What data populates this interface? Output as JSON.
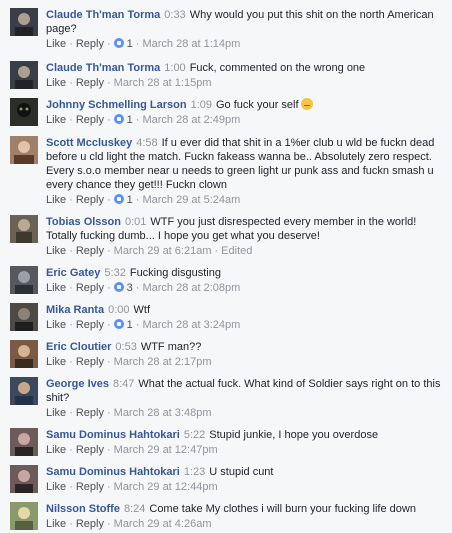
{
  "comments": [
    {
      "name": "Claude Th'man Torma",
      "time": "0:33",
      "text": "Why would you put this shit on the north American page?",
      "like": "Like",
      "reply": "Reply",
      "reactions": "1",
      "date": "March 28 at 1:14pm",
      "avatar": "#3a3f47"
    },
    {
      "name": "Claude Th'man Torma",
      "time": "1:00",
      "text": "Fuck, commented on the wrong one",
      "like": "Like",
      "reply": "Reply",
      "reactions": "",
      "date": "March 28 at 1:15pm",
      "avatar": "#3a3f47"
    },
    {
      "name": "Johnny Schmelling Larson",
      "time": "1:09",
      "text": "Go fuck your self",
      "like": "Like",
      "reply": "Reply",
      "reactions": "1",
      "date": "March 28 at 2:49pm",
      "avatar": "#2b2f2a"
    },
    {
      "name": "Scott Mccluskey",
      "time": "4:58",
      "text": "If u ever did that shit in a 1%er club u wld be fuckn dead before u cld light the match. Fuckn fakeass wanna be.. Absolutely zero respect. Every s.o.o member near u needs to green light ur punk ass and fuckn smash u every chance they get!!! Fuckn clown",
      "like": "Like",
      "reply": "Reply",
      "reactions": "1",
      "date": "March 29 at 5:24am",
      "avatar": "#a08068"
    },
    {
      "name": "Tobias Olsson",
      "time": "0:01",
      "text": "WTF you just disrespected every member in the world! Totally fucking dumb... I hope you get what you deserve!",
      "like": "Like",
      "reply": "Reply",
      "reactions": "",
      "date": "March 29 at 6:21am",
      "edited": "Edited",
      "avatar": "#6a6255"
    },
    {
      "name": "Eric Gatey",
      "time": "5:32",
      "text": "Fucking disgusting",
      "like": "Like",
      "reply": "Reply",
      "reactions": "3",
      "date": "March 28 at 2:08pm",
      "avatar": "#55585c"
    },
    {
      "name": "Mika Ranta",
      "time": "0:00",
      "text": "Wtf",
      "like": "Like",
      "reply": "Reply",
      "reactions": "1",
      "date": "March 28 at 3:24pm",
      "avatar": "#4d4a46"
    },
    {
      "name": "Eric Cloutier",
      "time": "0:53",
      "text": "WTF man??",
      "like": "Like",
      "reply": "Reply",
      "reactions": "",
      "date": "March 28 at 2:17pm",
      "avatar": "#7a5a45"
    },
    {
      "name": "George Ives",
      "time": "8:47",
      "text": "What the actual fuck. What kind of Soldier says right on to this shit?",
      "like": "Like",
      "reply": "Reply",
      "reactions": "",
      "date": "March 28 at 3:48pm",
      "avatar": "#3d4a5e"
    },
    {
      "name": "Samu Dominus Hahtokari",
      "time": "5:22",
      "text": "Stupid junkie, I hope you overdose",
      "like": "Like",
      "reply": "Reply",
      "reactions": "",
      "date": "March 29 at 12:47pm",
      "avatar": "#6b5c5a"
    },
    {
      "name": "Samu Dominus Hahtokari",
      "time": "1:23",
      "text": "U stupid cunt",
      "like": "Like",
      "reply": "Reply",
      "reactions": "",
      "date": "March 29 at 12:44pm",
      "avatar": "#6b5c5a"
    },
    {
      "name": "Nilsson Stoffe",
      "time": "8:24",
      "text": "Come take My clothes i will burn your fucking life down",
      "like": "Like",
      "reply": "Reply",
      "reactions": "",
      "date": "March 29 at 4:26am",
      "avatar": "#8a9a6a"
    }
  ]
}
